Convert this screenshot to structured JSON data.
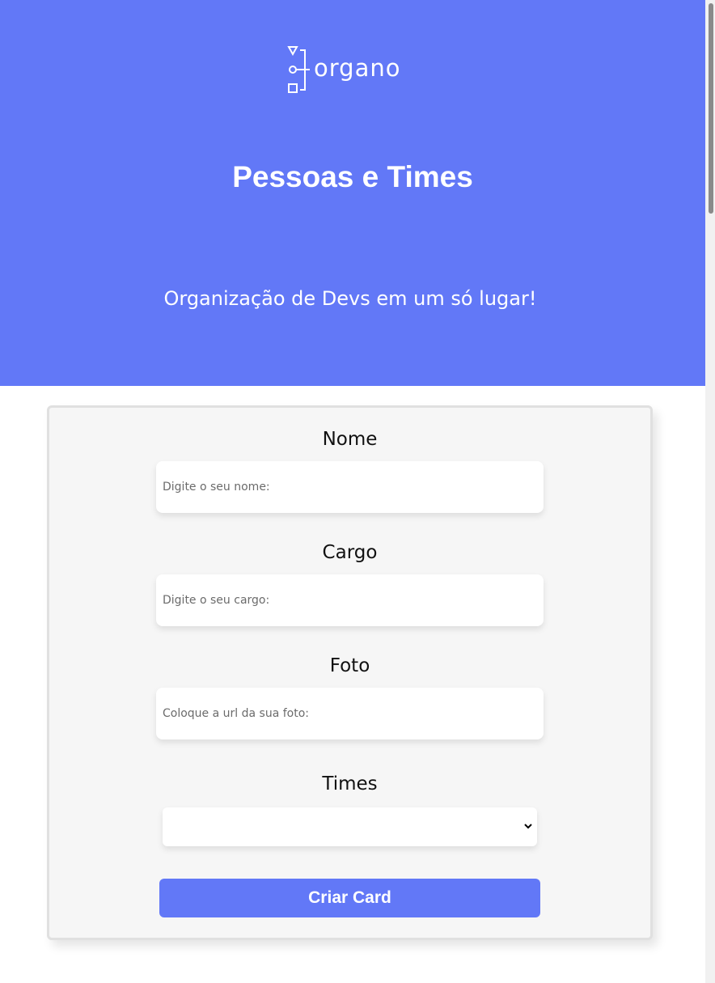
{
  "header": {
    "logo_text": "organo",
    "title": "Pessoas e Times",
    "subtitle": "Organização de Devs em um só lugar!",
    "background_color": "#6278f7",
    "logo_icon": "organo-logo-icon"
  },
  "form": {
    "fields": [
      {
        "label": "Nome",
        "placeholder": "Digite o seu nome:",
        "value": ""
      },
      {
        "label": "Cargo",
        "placeholder": "Digite o seu cargo:",
        "value": ""
      },
      {
        "label": "Foto",
        "placeholder": "Coloque a url da sua foto:",
        "value": ""
      }
    ],
    "teams": {
      "label": "Times",
      "selected": "",
      "icon": "chevron-down-icon"
    },
    "submit_label": "Criar Card",
    "accent_color": "#6278f7"
  }
}
